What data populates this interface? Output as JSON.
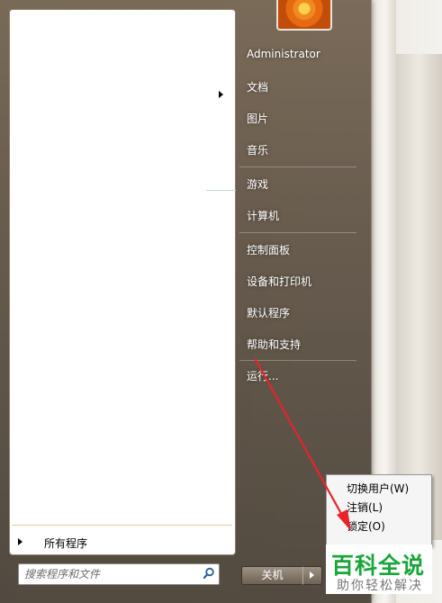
{
  "start_menu": {
    "all_programs_label": "所有程序",
    "search": {
      "placeholder": "搜索程序和文件"
    },
    "right_items": [
      {
        "label": "Administrator"
      },
      {
        "label": "文档"
      },
      {
        "label": "图片"
      },
      {
        "label": "音乐"
      },
      {
        "label": "游戏"
      },
      {
        "label": "计算机"
      },
      {
        "label": "控制面板"
      },
      {
        "label": "设备和打印机"
      },
      {
        "label": "默认程序"
      },
      {
        "label": "帮助和支持"
      },
      {
        "label": "运行..."
      }
    ],
    "shutdown_label": "关机"
  },
  "shutdown_submenu": {
    "items": [
      {
        "label": "切换用户(W)"
      },
      {
        "label": "注销(L)"
      },
      {
        "label": "锁定(O)"
      }
    ]
  },
  "watermark": {
    "title": "百科全说",
    "subtitle": "助你轻松解决"
  },
  "colors": {
    "annotation_arrow": "#e8232a",
    "watermark_green": "#1aa53a"
  },
  "icons": [
    "search-icon",
    "arrow-right-icon",
    "user-picture",
    "arrow-annotation"
  ]
}
